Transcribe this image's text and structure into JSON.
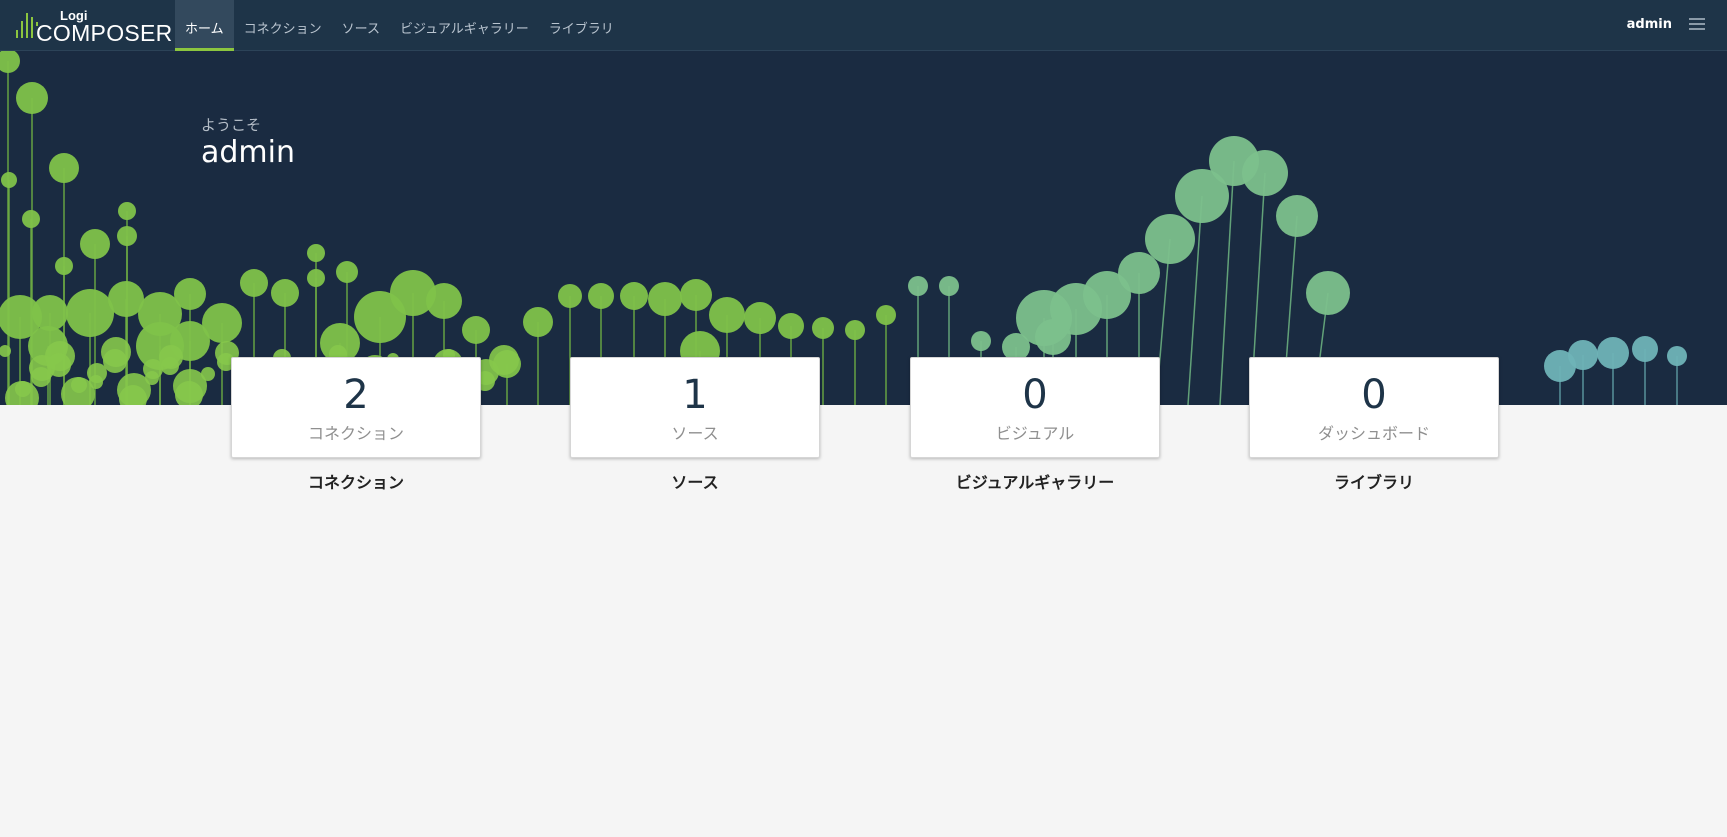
{
  "app": {
    "logo_small": "Logi",
    "logo_large": "COMPOSER"
  },
  "nav": {
    "items": [
      {
        "label": "ホーム",
        "active": true
      },
      {
        "label": "コネクション",
        "active": false
      },
      {
        "label": "ソース",
        "active": false
      },
      {
        "label": "ビジュアルギャラリー",
        "active": false
      },
      {
        "label": "ライブラリ",
        "active": false
      }
    ]
  },
  "header": {
    "user": "admin",
    "menu_icon": "hamburger-menu-icon"
  },
  "hero": {
    "welcome": "ようこそ",
    "user": "admin"
  },
  "cards": [
    {
      "count": "2",
      "label": "コネクション",
      "link": "コネクション"
    },
    {
      "count": "1",
      "label": "ソース",
      "link": "ソース"
    },
    {
      "count": "0",
      "label": "ビジュアル",
      "link": "ビジュアルギャラリー"
    },
    {
      "count": "0",
      "label": "ダッシュボード",
      "link": "ライブラリ"
    }
  ],
  "colors": {
    "topbar": "#1e3448",
    "hero": "#1a2b41",
    "accent": "#8cc63f",
    "page_bg": "#f5f5f5"
  }
}
